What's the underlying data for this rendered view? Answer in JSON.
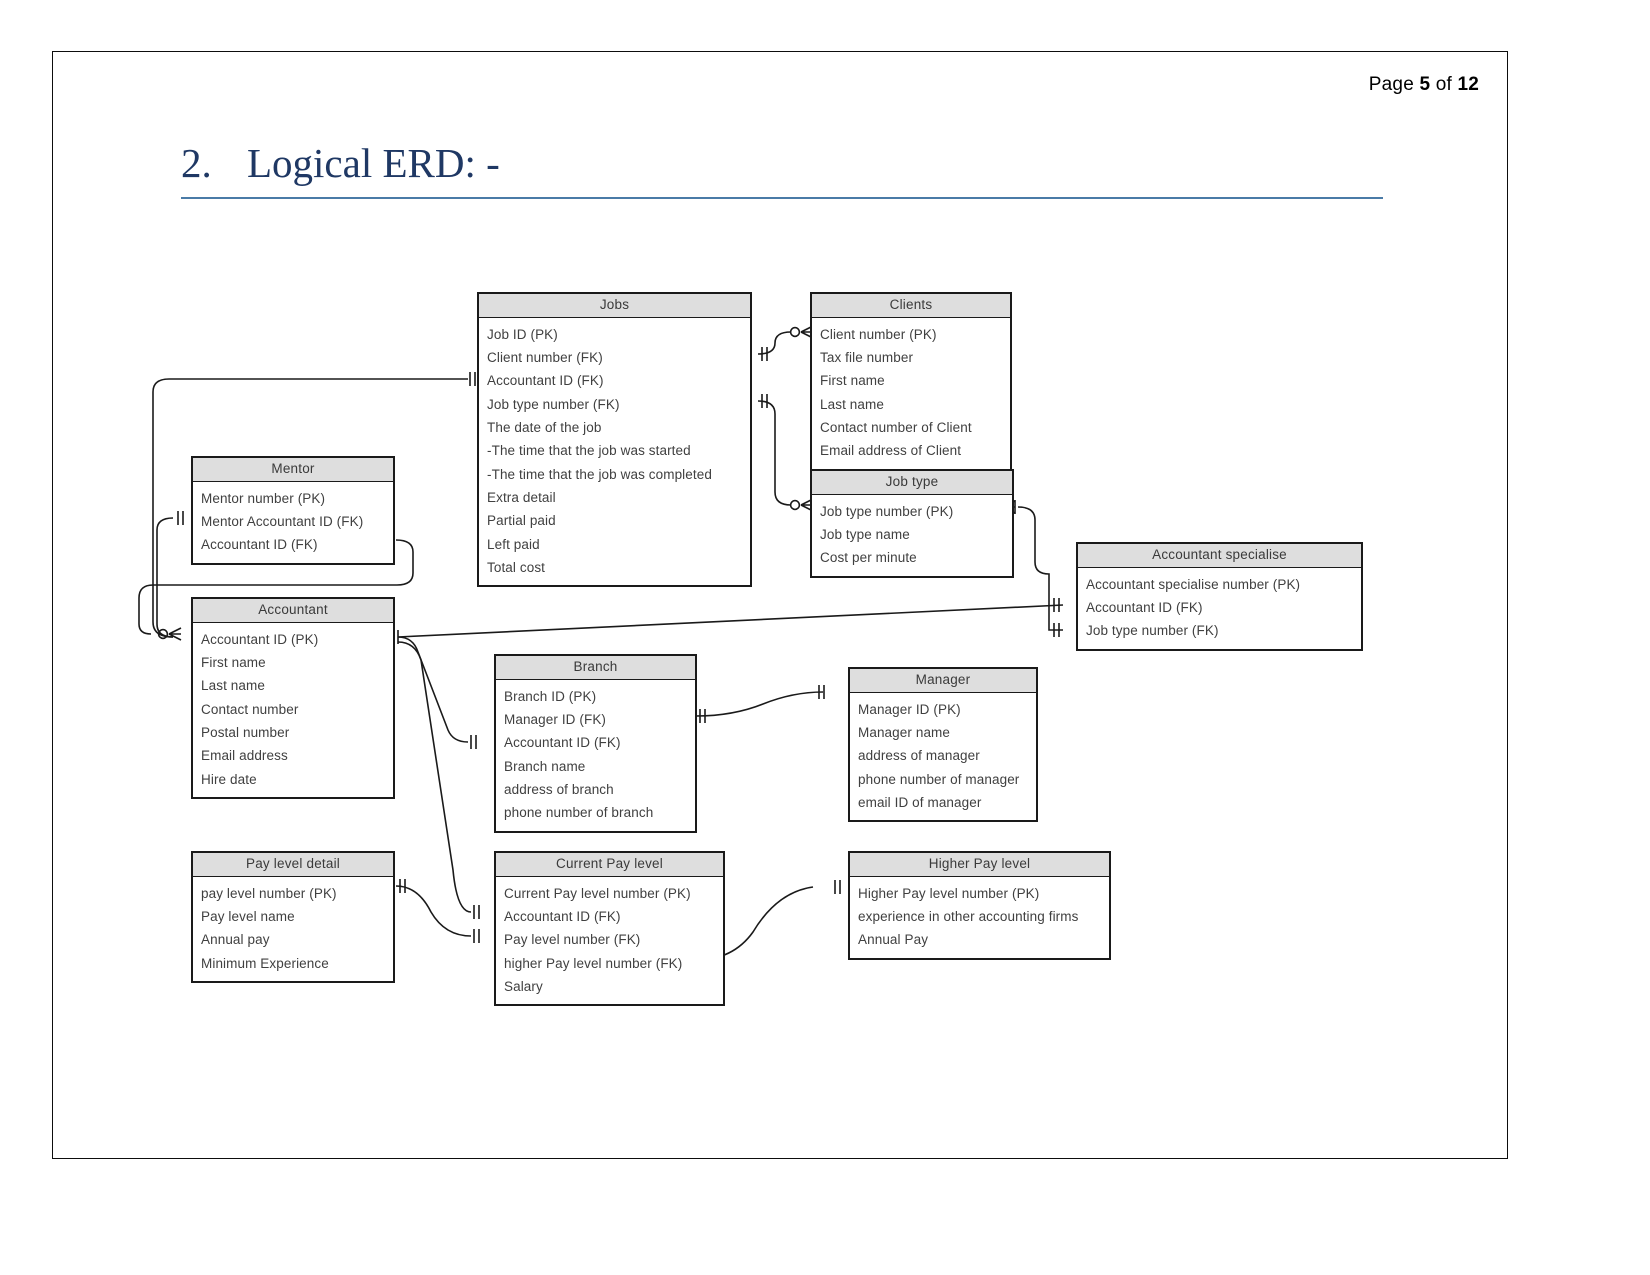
{
  "document": {
    "page_label_prefix": "Page",
    "page_current": "5",
    "page_of": "of",
    "page_total": "12"
  },
  "heading": {
    "number": "2.",
    "text": "Logical ERD: -"
  },
  "diagram": {
    "type": "entity-relationship-diagram",
    "notation": "crows-foot",
    "entities": [
      {
        "id": "jobs",
        "title": "Jobs",
        "attributes": [
          "Job ID (PK)",
          "Client number (FK)",
          "Accountant ID (FK)",
          "Job type number (FK)",
          "The date of the job",
          "-The time that the job was started",
          "-The time that the job was completed",
          "Extra detail",
          "Partial paid",
          "Left paid",
          "Total cost"
        ]
      },
      {
        "id": "clients",
        "title": "Clients",
        "attributes": [
          "Client number (PK)",
          "Tax file number",
          "First name",
          "Last name",
          "Contact number of Client",
          "Email address of Client"
        ]
      },
      {
        "id": "job-type",
        "title": "Job type",
        "attributes": [
          "Job type number (PK)",
          "Job type name",
          "Cost per minute"
        ]
      },
      {
        "id": "mentor",
        "title": "Mentor",
        "attributes": [
          "Mentor number (PK)",
          "Mentor Accountant ID (FK)",
          "Accountant ID (FK)"
        ]
      },
      {
        "id": "accountant",
        "title": "Accountant",
        "attributes": [
          "Accountant ID (PK)",
          "First name",
          "Last name",
          "Contact number",
          "Postal number",
          "Email address",
          "Hire date"
        ]
      },
      {
        "id": "accountant-specialise",
        "title": "Accountant specialise",
        "attributes": [
          "Accountant specialise number (PK)",
          "Accountant ID (FK)",
          "Job type number (FK)"
        ]
      },
      {
        "id": "branch",
        "title": "Branch",
        "attributes": [
          "Branch ID (PK)",
          "Manager ID (FK)",
          "Accountant ID (FK)",
          "Branch name",
          "address of branch",
          "phone number of branch"
        ]
      },
      {
        "id": "manager",
        "title": "Manager",
        "attributes": [
          "Manager ID (PK)",
          "Manager name",
          "address of manager",
          "phone number of manager",
          "email ID of manager"
        ]
      },
      {
        "id": "pay-level-detail",
        "title": "Pay level detail",
        "attributes": [
          "pay level number (PK)",
          "Pay level name",
          "Annual pay",
          "Minimum Experience"
        ]
      },
      {
        "id": "current-pay-level",
        "title": "Current Pay level",
        "attributes": [
          "Current Pay level number (PK)",
          "Accountant ID (FK)",
          "Pay level number (FK)",
          "higher Pay level number (FK)",
          "Salary"
        ]
      },
      {
        "id": "higher-pay-level",
        "title": "Higher Pay level",
        "attributes": [
          "Higher Pay level number (PK)",
          "experience in other accounting firms",
          "Annual Pay"
        ]
      }
    ],
    "relationships": [
      {
        "from": "accountant",
        "to": "jobs",
        "from_card": "one",
        "to_card": "one"
      },
      {
        "from": "jobs",
        "to": "clients",
        "from_card": "one",
        "to_card": "zero-or-many"
      },
      {
        "from": "jobs",
        "to": "job-type",
        "from_card": "one",
        "to_card": "zero-or-many"
      },
      {
        "from": "accountant",
        "to": "mentor",
        "from_card": "zero-or-many",
        "to_card": "one"
      },
      {
        "from": "mentor",
        "to": "accountant",
        "from_card": "one",
        "to_card": "zero-or-many"
      },
      {
        "from": "job-type",
        "to": "accountant-specialise",
        "from_card": "one",
        "to_card": "one"
      },
      {
        "from": "accountant",
        "to": "accountant-specialise",
        "from_card": "one",
        "to_card": "one"
      },
      {
        "from": "accountant",
        "to": "branch",
        "from_card": "one",
        "to_card": "one"
      },
      {
        "from": "branch",
        "to": "manager",
        "from_card": "one",
        "to_card": "one"
      },
      {
        "from": "accountant",
        "to": "current-pay-level",
        "from_card": "one",
        "to_card": "one"
      },
      {
        "from": "pay-level-detail",
        "to": "current-pay-level",
        "from_card": "one",
        "to_card": "one"
      },
      {
        "from": "current-pay-level",
        "to": "higher-pay-level",
        "from_card": "one",
        "to_card": "one"
      }
    ]
  },
  "colors": {
    "title_color": "#1f3864",
    "title_rule": "#4a7ba7",
    "entity_header_fill": "#dedede",
    "entity_border": "#1a1a1a",
    "text": "#404040"
  }
}
